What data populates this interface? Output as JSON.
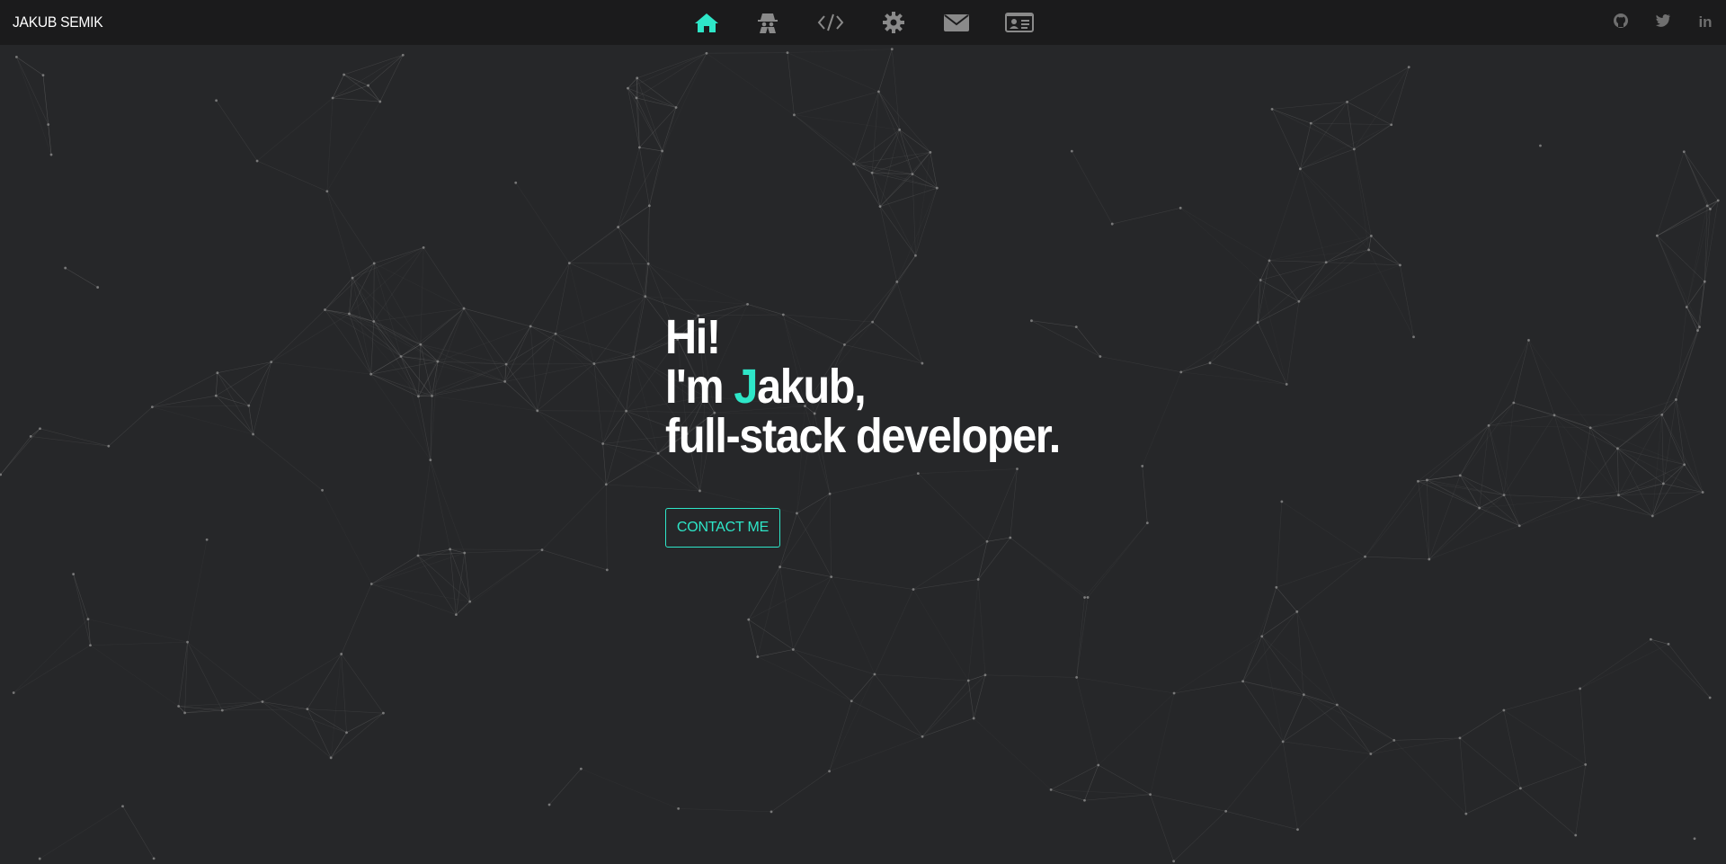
{
  "navbar": {
    "brand": "JAKUB SEMIK",
    "items": [
      {
        "icon": "home-icon",
        "active": true
      },
      {
        "icon": "spy-icon",
        "active": false
      },
      {
        "icon": "code-icon",
        "active": false
      },
      {
        "icon": "gear-icon",
        "active": false
      },
      {
        "icon": "envelope-icon",
        "active": false
      },
      {
        "icon": "id-card-icon",
        "active": false
      }
    ],
    "social": [
      {
        "icon": "github-icon"
      },
      {
        "icon": "twitter-icon"
      },
      {
        "icon": "linkedin-icon",
        "text": "in"
      }
    ]
  },
  "hero": {
    "line1": "Hi!",
    "line2_prefix": "I'm ",
    "line2_accent": "J",
    "line2_rest": "akub,",
    "line3": "full-stack developer.",
    "cta": "CONTACT ME"
  },
  "colors": {
    "accent": "#2ee6c8",
    "background": "#262729",
    "navbar": "#1b1b1c",
    "icon_muted": "#8a8a8a"
  }
}
